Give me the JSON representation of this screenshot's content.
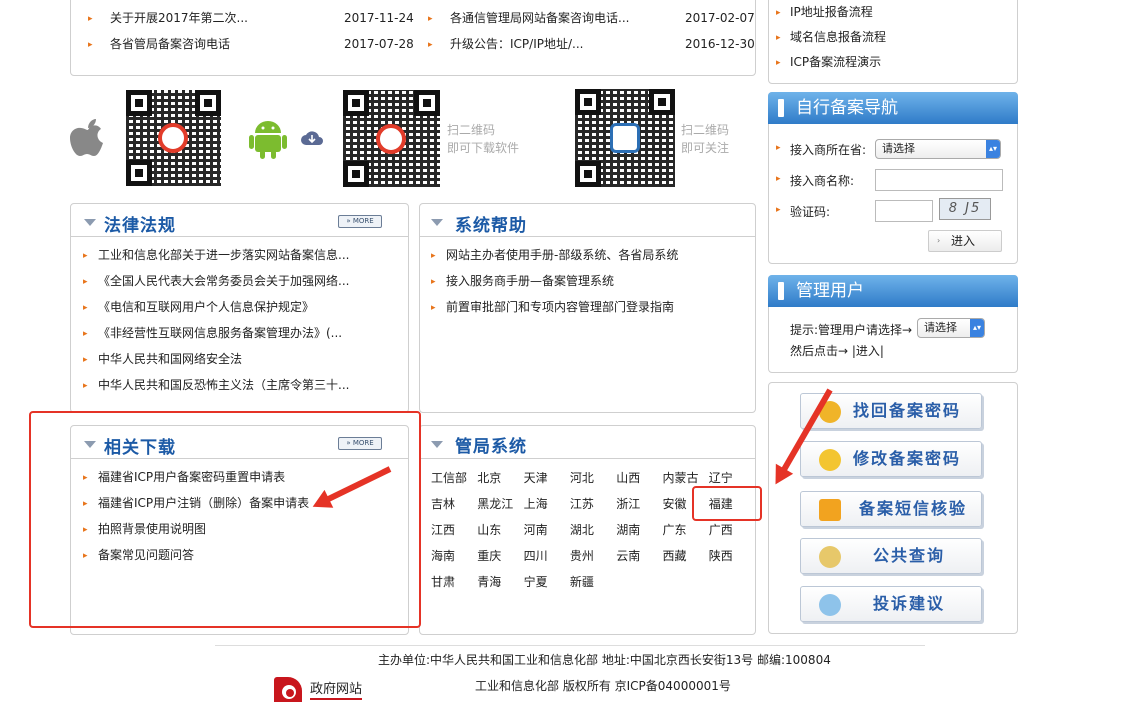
{
  "news": [
    {
      "title": "关于开展2017年第二次...",
      "date": "2017-11-24"
    },
    {
      "title": "各省管局备案咨询电话",
      "date": "2017-07-28"
    },
    {
      "title": "各通信管理局网站备案咨询电话...",
      "date": "2017-02-07"
    },
    {
      "title": "升级公告：ICP/IP地址/...",
      "date": "2016-12-30"
    }
  ],
  "process_links": [
    "IP地址报备流程",
    "域名信息报备流程",
    "ICP备案流程演示"
  ],
  "qr": {
    "scan_download": [
      "扫二维码",
      "即可下载软件"
    ],
    "scan_follow": [
      "扫二维码",
      "即可关注"
    ]
  },
  "laws": {
    "title": "法律法规",
    "more": "MORE",
    "items": [
      "工业和信息化部关于进一步落实网站备案信息...",
      "《全国人民代表大会常务委员会关于加强网络...",
      "《电信和互联网用户个人信息保护规定》",
      "《非经营性互联网信息服务备案管理办法》(...",
      "中华人民共和国网络安全法",
      "中华人民共和国反恐怖主义法（主席令第三十..."
    ]
  },
  "help": {
    "title": "系统帮助",
    "items": [
      "网站主办者使用手册-部级系统、各省局系统",
      "接入服务商手册—备案管理系统",
      "前置审批部门和专项内容管理部门登录指南"
    ]
  },
  "downloads": {
    "title": "相关下载",
    "more": "MORE",
    "items": [
      "福建省ICP用户备案密码重置申请表",
      "福建省ICP用户注销（删除）备案申请表",
      "拍照背景使用说明图",
      "备案常见问题问答"
    ]
  },
  "bureaus": {
    "title": "管局系统",
    "rows": [
      [
        "工信部",
        "北京",
        "天津",
        "河北",
        "山西",
        "内蒙古",
        "辽宁"
      ],
      [
        "吉林",
        "黑龙江",
        "上海",
        "江苏",
        "浙江",
        "安徽",
        "福建"
      ],
      [
        "江西",
        "山东",
        "河南",
        "湖北",
        "湖南",
        "广东",
        "广西"
      ],
      [
        "海南",
        "重庆",
        "四川",
        "贵州",
        "云南",
        "西藏",
        "陕西"
      ],
      [
        "甘肃",
        "青海",
        "宁夏",
        "新疆"
      ]
    ]
  },
  "nav": {
    "title": "自行备案导航",
    "province_label": "接入商所在省:",
    "province_value": "请选择",
    "name_label": "接入商名称:",
    "code_label": "验证码:",
    "captcha": "8 J5",
    "enter": "进入"
  },
  "admin": {
    "title": "管理用户",
    "hint1": "提示:管理用户请选择→",
    "select": "请选择",
    "hint2": "然后点击→ |进入|"
  },
  "actions": [
    "找回备案密码",
    "修改备案密码",
    "备案短信核验",
    "公共查询",
    "投诉建议"
  ],
  "footer": {
    "line1": "主办单位:中华人民共和国工业和信息化部 地址:中国北京西长安街13号 邮编:100804",
    "line2": "工业和信息化部 版权所有 京ICP备04000001号",
    "gov_logo": "政府网站"
  },
  "colors": {
    "accent": "#1c5aa6",
    "bullet": "#e8741a",
    "annotation": "#e53326"
  }
}
